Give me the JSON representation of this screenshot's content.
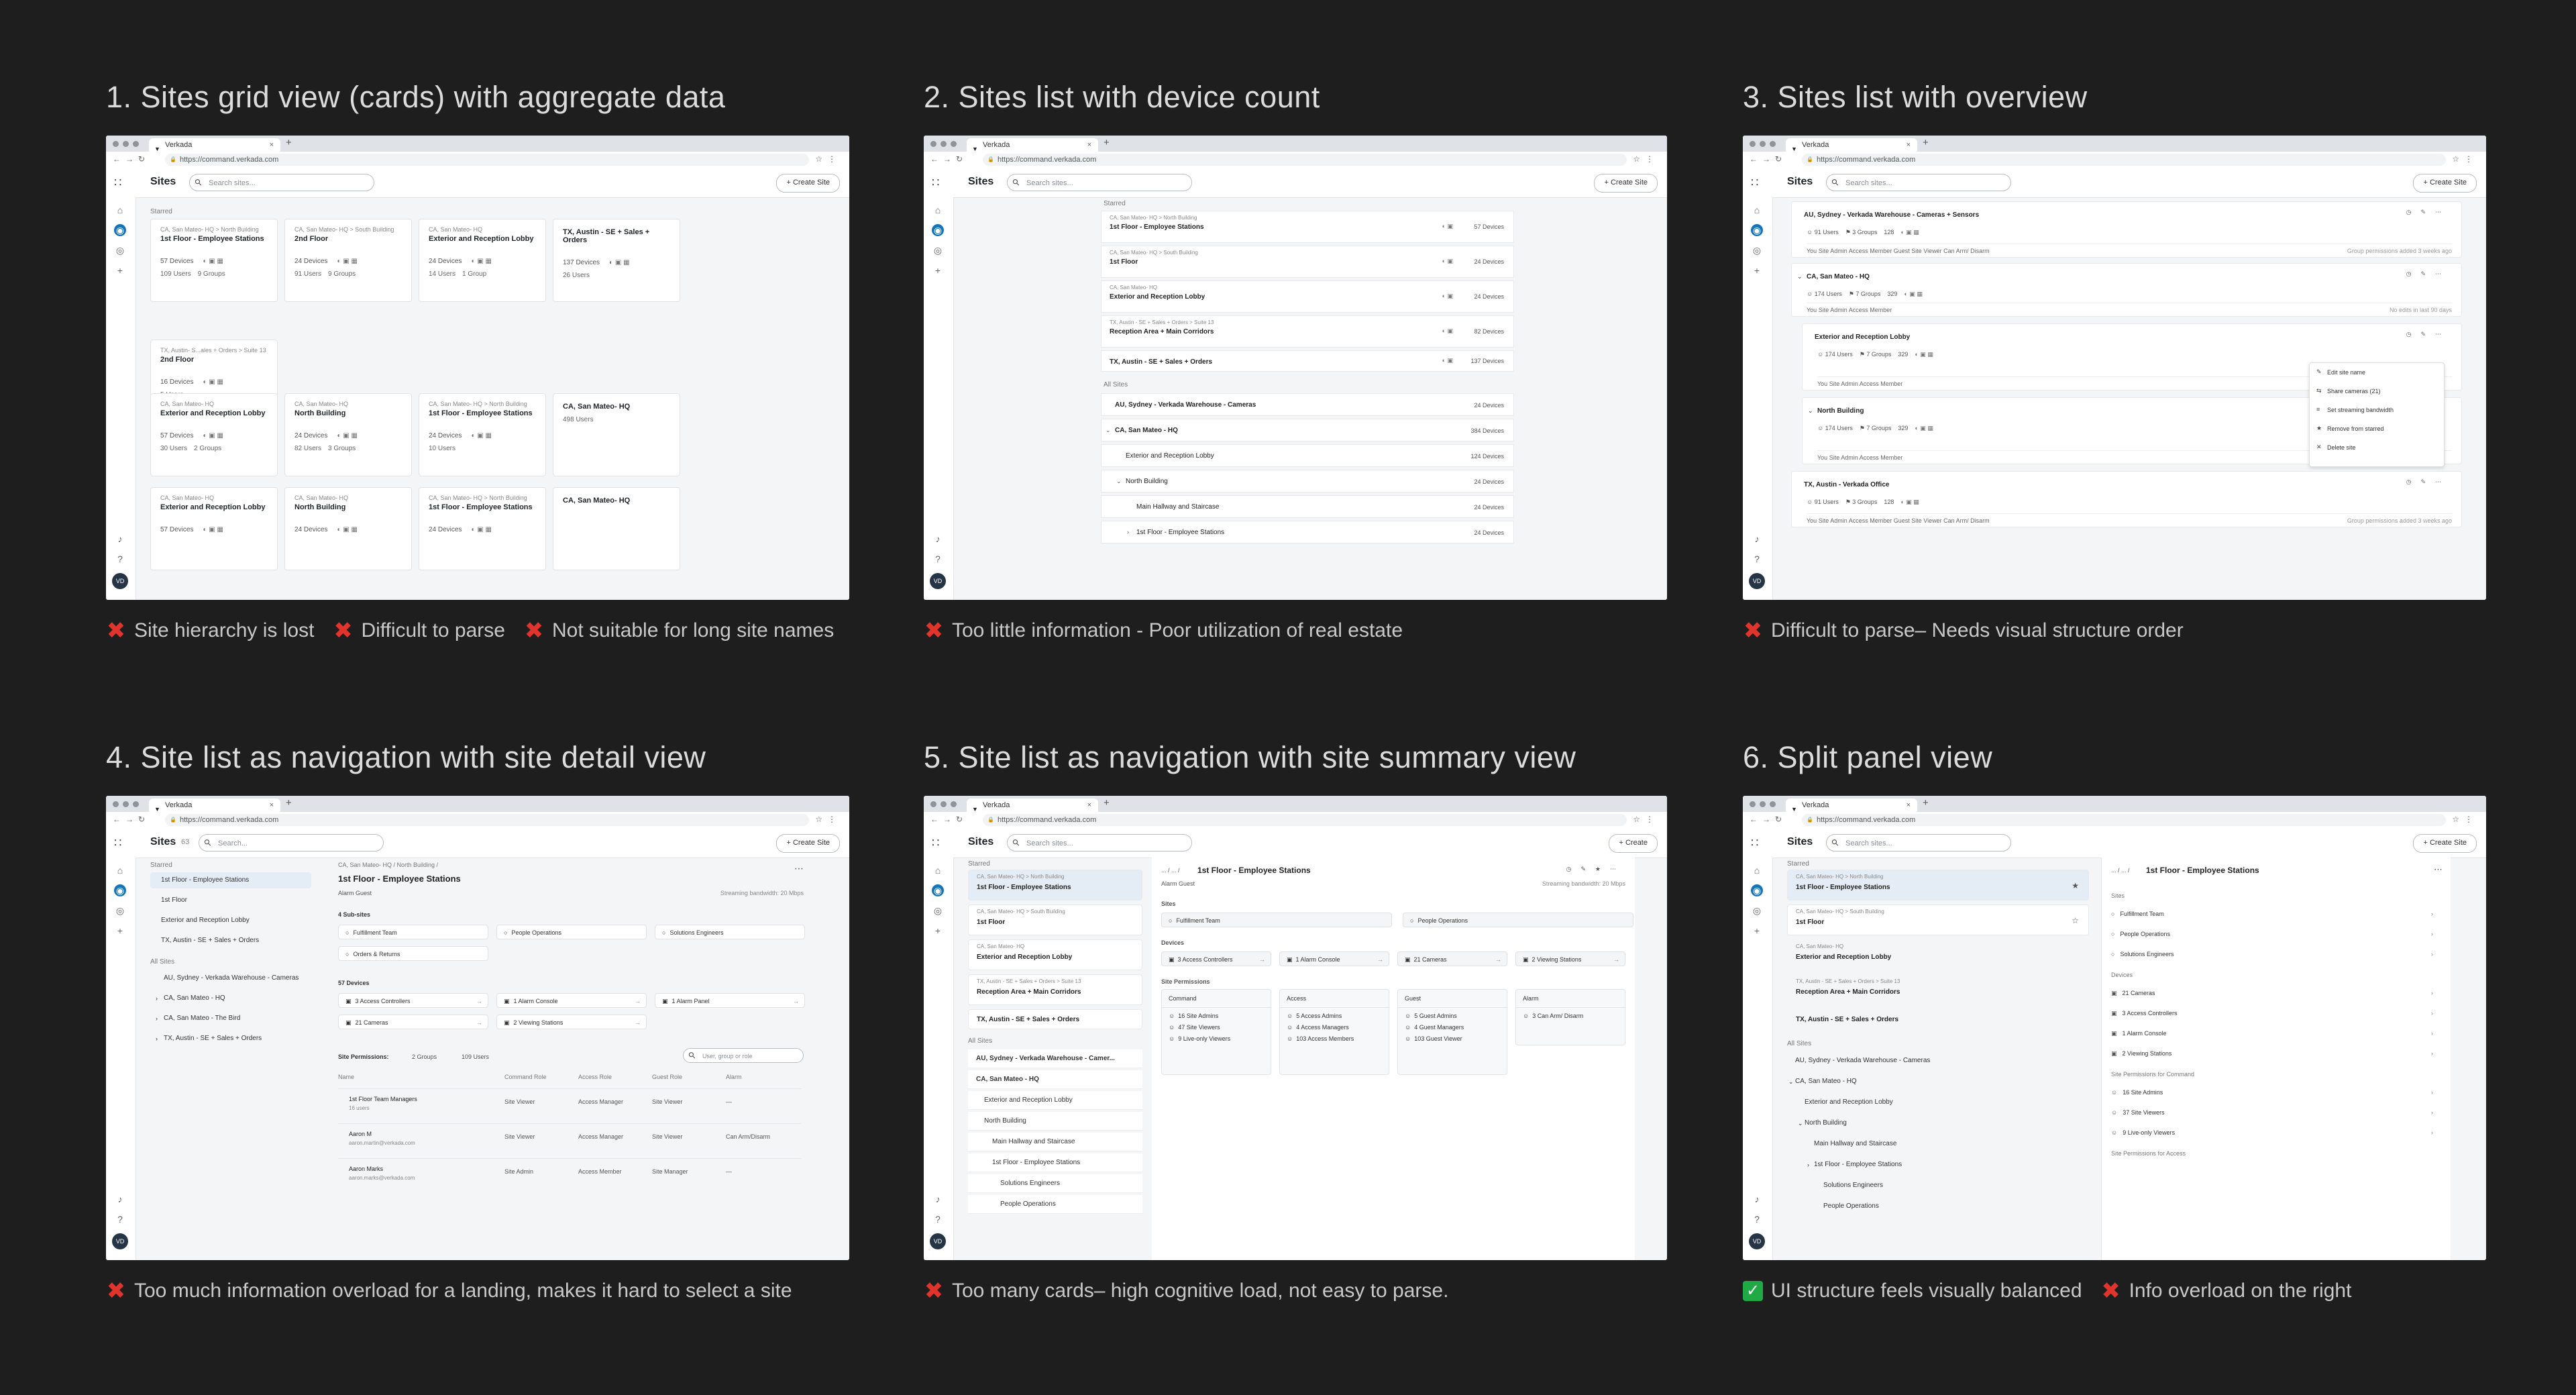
{
  "browser": {
    "tab_title": "Verkada",
    "url": "https://command.verkada.com"
  },
  "app": {
    "sites_title": "Sites",
    "search_placeholder": "Search sites...",
    "create_site": "Create Site",
    "create": "Create",
    "avatar": "VD",
    "sites_count": "63",
    "search_placeholder_alt": "Search..."
  },
  "panels": [
    {
      "title": "1. Sites grid view (cards) with aggregate data",
      "notes": [
        {
          "type": "bad",
          "text": "Site hierarchy is lost"
        },
        {
          "type": "bad",
          "text": "Difficult to parse"
        },
        {
          "type": "bad",
          "text": "Not suitable for long site names"
        }
      ],
      "sections": [
        "Starred",
        "All Sites"
      ],
      "cards": [
        {
          "bc": "CA, San Mateo- HQ > North Building",
          "name": "1st Floor - Employee Stations",
          "devices": "57 Devices",
          "users": "109 Users",
          "groups": "9 Groups"
        },
        {
          "bc": "CA, San Mateo- HQ > South Building",
          "name": "2nd Floor",
          "devices": "24 Devices",
          "users": "91 Users",
          "groups": "9 Groups"
        },
        {
          "bc": "CA, San Mateo- HQ",
          "name": "Exterior and Reception Lobby",
          "devices": "24 Devices",
          "users": "14 Users",
          "groups": "1 Group"
        },
        {
          "bc": "",
          "name": "TX, Austin - SE + Sales + Orders",
          "devices": "137 Devices",
          "users": "26 Users",
          "groups": ""
        },
        {
          "bc": "TX, Austin- S...ales + Orders > Suite 13",
          "name": "2nd Floor",
          "devices": "16 Devices",
          "users": "5 Users",
          "groups": ""
        },
        {
          "bc": "CA, San Mateo- HQ",
          "name": "Exterior and Reception Lobby",
          "devices": "57 Devices",
          "users": "30 Users",
          "groups": "2 Groups"
        },
        {
          "bc": "CA, San Mateo- HQ",
          "name": "North Building",
          "devices": "24 Devices",
          "users": "82 Users",
          "groups": "3 Groups"
        },
        {
          "bc": "CA, San Mateo- HQ > North Building",
          "name": "1st Floor - Employee Stations",
          "devices": "24 Devices",
          "users": "10 Users",
          "groups": ""
        },
        {
          "bc": "",
          "name": "CA, San Mateo- HQ",
          "devices": "",
          "users": "498 Users",
          "groups": ""
        },
        {
          "bc": "CA, San Mateo- HQ",
          "name": "Exterior and Reception Lobby",
          "devices": "57 Devices",
          "users": "",
          "groups": ""
        },
        {
          "bc": "CA, San Mateo- HQ",
          "name": "North Building",
          "devices": "24 Devices",
          "users": "",
          "groups": ""
        },
        {
          "bc": "CA, San Mateo- HQ > North Building",
          "name": "1st Floor - Employee Stations",
          "devices": "24 Devices",
          "users": "",
          "groups": ""
        },
        {
          "bc": "",
          "name": "CA, San Mateo- HQ",
          "devices": "",
          "users": "",
          "groups": ""
        }
      ]
    },
    {
      "title": "2. Sites list with device count",
      "notes": [
        {
          "type": "bad",
          "text": "Too little information - Poor utilization of real estate"
        }
      ],
      "starred": [
        {
          "bc": "CA, San Mateo- HQ > North Building",
          "name": "1st Floor - Employee Stations",
          "count": "57 Devices"
        },
        {
          "bc": "CA, San Mateo- HQ > South Building",
          "name": "1st Floor",
          "count": "24 Devices"
        },
        {
          "bc": "CA, San Mateo- HQ",
          "name": "Exterior and Reception Lobby",
          "count": "24 Devices"
        },
        {
          "bc": "TX, Austin - SE + Sales + Orders > Suite 13",
          "name": "Reception Area + Main Corridors",
          "count": "82 Devices"
        },
        {
          "bc": "",
          "name": "TX, Austin - SE + Sales + Orders",
          "count": "137 Devices"
        }
      ],
      "all": [
        {
          "name": "AU, Sydney - Verkada Warehouse - Cameras",
          "count": "24 Devices",
          "indent": 0
        },
        {
          "name": "CA, San Mateo - HQ",
          "count": "384 Devices",
          "indent": 0
        },
        {
          "name": "Exterior and Reception Lobby",
          "count": "124 Devices",
          "indent": 1
        },
        {
          "name": "North Building",
          "count": "24 Devices",
          "indent": 1
        },
        {
          "name": "Main Hallway and Staircase",
          "count": "24 Devices",
          "indent": 2
        },
        {
          "name": "1st Floor - Employee Stations",
          "count": "24 Devices",
          "indent": 2
        }
      ],
      "sections": [
        "Starred",
        "All Sites"
      ]
    },
    {
      "title": "3. Sites list with overview",
      "notes": [
        {
          "type": "bad",
          "text": "Difficult to parse– Needs visual structure order"
        }
      ],
      "rows": [
        {
          "name": "AU, Sydney - Verkada Warehouse - Cameras + Sensors",
          "users": "91 Users",
          "groups": "3 Groups",
          "count": "128",
          "roles": "You  Site Admin  Access Member  Guest Site Viewer  Can Arm/ Disarm",
          "meta": "Group permissions added 3 weeks ago"
        },
        {
          "name": "CA, San Mateo - HQ",
          "users": "174 Users",
          "groups": "7 Groups",
          "count": "329",
          "roles": "You  Site Admin  Access Member",
          "meta": "No edits in last 90 days"
        },
        {
          "name": "Exterior and Reception Lobby",
          "users": "174 Users",
          "groups": "7 Groups",
          "count": "329",
          "roles": "You  Site Admin  Access Member",
          "meta": ""
        },
        {
          "name": "North Building",
          "users": "174 Users",
          "groups": "7 Groups",
          "count": "329",
          "roles": "You  Site Admin  Access Member",
          "meta": ""
        },
        {
          "name": "TX, Austin - Verkada Office",
          "users": "91 Users",
          "groups": "3 Groups",
          "count": "128",
          "roles": "You  Site Admin  Access Member  Guest Site Viewer  Can Arm/ Disarm",
          "meta": "Group permissions added 3 weeks ago"
        }
      ],
      "menu": [
        "Edit site name",
        "Share cameras (21)",
        "Set streaming bandwidth",
        "Remove from starred",
        "Delete site"
      ]
    },
    {
      "title": "4. Site list as navigation with site detail view",
      "notes": [
        {
          "type": "bad",
          "text": "Too much information overload for a landing, makes it hard to select a site"
        }
      ],
      "sidebar_starred": [
        "1st Floor - Employee Stations",
        "1st Floor",
        "Exterior and Reception Lobby",
        "TX, Austin - SE + Sales + Orders"
      ],
      "sidebar_all": [
        "AU, Sydney - Verkada Warehouse - Cameras",
        "CA, San Mateo - HQ",
        "CA, San Mateo - The Bird",
        "TX, Austin - SE + Sales + Orders"
      ],
      "breadcrumb": "CA, San Mateo- HQ  /  North Building  /",
      "detail_title": "1st Floor - Employee Stations",
      "badges": "Alarm   Guest",
      "bandwidth": "Streaming bandwidth: 20 Mbps",
      "subsites_label": "4 Sub-sites",
      "subsites": [
        "Fulfillment Team",
        "People Operations",
        "Solutions Engineers",
        "Orders & Returns"
      ],
      "devices_label": "57 Devices",
      "devices": [
        "3 Access Controllers",
        "1 Alarm Console",
        "1 Alarm Panel",
        "21 Cameras",
        "2 Viewing Stations"
      ],
      "permissions_label": "Site Permissions:",
      "perm_groups": "2 Groups",
      "perm_users": "109 Users",
      "perm_search": "User, group or role",
      "perm_headers": [
        "Name",
        "Command Role",
        "Access Role",
        "Guest Role",
        "Alarm"
      ],
      "perm_rows": [
        {
          "name": "1st Floor Team Managers",
          "sub": "16 users",
          "c": "Site Viewer",
          "a": "Access Manager",
          "g": "Site Viewer",
          "al": "—"
        },
        {
          "name": "Aaron M",
          "sub": "aaron.martin@verkada.com",
          "c": "Site Viewer",
          "a": "Access Manager",
          "g": "Site Viewer",
          "al": "Can Arm/Disarm"
        },
        {
          "name": "Aaron Marks",
          "sub": "aaron.marks@verkada.com",
          "c": "Site Admin",
          "a": "Access Member",
          "g": "Site Manager",
          "al": "—"
        }
      ]
    },
    {
      "title": "5. Site list as navigation with site summary view",
      "notes": [
        {
          "type": "bad",
          "text": "Too many cards– high cognitive load, not easy to parse."
        }
      ],
      "side": [
        {
          "bc": "CA, San Mateo- HQ > North Building",
          "name": "1st Floor - Employee Stations"
        },
        {
          "bc": "CA, San Mateo- HQ > South Building",
          "name": "1st Floor"
        },
        {
          "bc": "CA, San Mateo- HQ",
          "name": "Exterior and Reception Lobby"
        },
        {
          "bc": "TX, Austin - SE + Sales + Orders > Suite 13",
          "name": "Reception Area + Main Corridors"
        },
        {
          "bc": "",
          "name": "TX, Austin - SE + Sales + Orders"
        }
      ],
      "side_all": [
        "AU, Sydney - Verkada Warehouse - Camer...",
        "CA, San Mateo - HQ",
        "Exterior and Reception Lobby",
        "North Building",
        "Main Hallway and Staircase",
        "1st Floor - Employee Stations",
        "Solutions Engineers",
        "People Operations"
      ],
      "breadcrumb": "... / ... /",
      "title_main": "1st Floor - Employee Stations",
      "badges": "Alarm   Guest",
      "bandwidth": "Streaming bandwidth: 20 Mbps",
      "sites_label": "Sites",
      "sites": [
        "Fulfillment Team",
        "People Operations"
      ],
      "devices_label": "Devices",
      "devices": [
        "3 Access Controllers",
        "1 Alarm Console",
        "21 Cameras",
        "2 Viewing Stations"
      ],
      "perm_label": "Site Permissions",
      "perm_cols": [
        {
          "h": "Command",
          "items": [
            "16 Site Admins",
            "47 Site Viewers",
            "9 Live-only Viewers"
          ]
        },
        {
          "h": "Access",
          "items": [
            "5 Access Admins",
            "4 Access Managers",
            "103 Access Members"
          ]
        },
        {
          "h": "Guest",
          "items": [
            "5 Guest Admins",
            "4 Guest Managers",
            "103 Guest Viewer"
          ]
        },
        {
          "h": "Alarm",
          "items": [
            "3 Can Arm/ Disarm"
          ]
        }
      ],
      "sections": [
        "Starred",
        "All Sites"
      ]
    },
    {
      "title": "6. Split panel view",
      "notes": [
        {
          "type": "good",
          "text": "UI structure feels visually balanced"
        },
        {
          "type": "bad",
          "text": "Info overload on the right"
        }
      ],
      "side": [
        {
          "bc": "CA, San Mateo- HQ > North Building",
          "name": "1st Floor - Employee Stations"
        },
        {
          "bc": "CA, San Mateo- HQ > South Building",
          "name": "1st Floor"
        },
        {
          "bc": "CA, San Mateo- HQ",
          "name": "Exterior and Reception Lobby"
        },
        {
          "bc": "TX, Austin - SE + Sales + Orders > Suite 13",
          "name": "Reception Area + Main Corridors"
        },
        {
          "bc": "",
          "name": "TX, Austin - SE + Sales + Orders"
        }
      ],
      "side_all": [
        "AU, Sydney - Verkada Warehouse - Cameras",
        "CA, San Mateo - HQ",
        "Exterior and Reception Lobby",
        "North Building",
        "Main Hallway and Staircase",
        "1st Floor - Employee Stations",
        "Solutions Engineers",
        "People Operations"
      ],
      "breadcrumb": "... / ... /",
      "title_main": "1st Floor - Employee Stations",
      "sites_label": "Sites",
      "sites": [
        "Fulfillment Team",
        "People Operations",
        "Solutions Engineers"
      ],
      "devices_label": "Devices",
      "devices": [
        "21 Cameras",
        "3 Access Controllers",
        "1 Alarm Console",
        "2 Viewing Stations"
      ],
      "perm_label": "Site Permissions for Command",
      "perms": [
        "16 Site Admins",
        "37 Site Viewers",
        "9 Live-only Viewers"
      ],
      "perm_label2": "Site Permissions for Access",
      "sections": [
        "Starred",
        "All Sites"
      ]
    }
  ]
}
